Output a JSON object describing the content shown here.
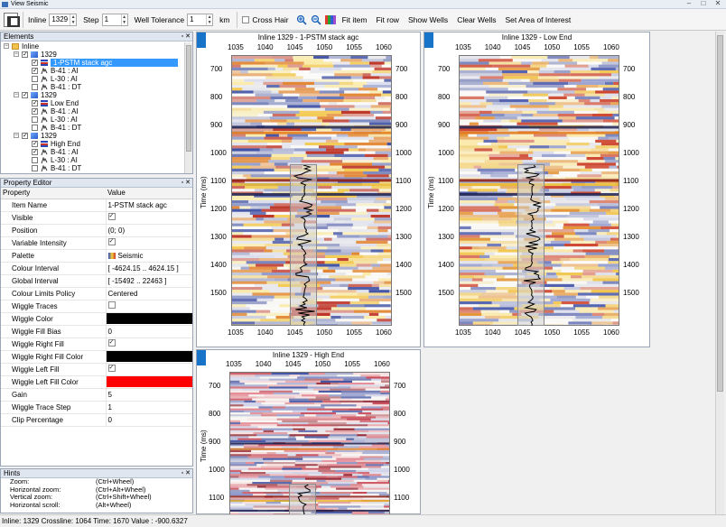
{
  "window": {
    "title": "View Seismic"
  },
  "toolbar": {
    "inline_label": "Inline",
    "inline_value": "1329",
    "step_label": "Step",
    "step_value": "1",
    "well_tolerance_label": "Well Tolerance",
    "well_tolerance_value": "1",
    "km_label": "km",
    "cross_hair_label": "Cross Hair",
    "fit_item_label": "Fit item",
    "fit_row_label": "Fit row",
    "show_wells_label": "Show Wells",
    "clear_wells_label": "Clear Wells",
    "set_area_label": "Set Area of Interest"
  },
  "elements_panel": {
    "title": "Elements",
    "root_label": "Inline",
    "groups": [
      {
        "label": "1329",
        "layer": "1-PSTM stack agc",
        "selected": true,
        "wells": [
          {
            "label": "B-41 : AI",
            "checked": true
          },
          {
            "label": "L-30 : AI",
            "checked": false
          },
          {
            "label": "B-41 : DT",
            "checked": false
          }
        ]
      },
      {
        "label": "1329",
        "layer": "Low End",
        "selected": false,
        "wells": [
          {
            "label": "B-41 : AI",
            "checked": true
          },
          {
            "label": "L-30 : AI",
            "checked": false
          },
          {
            "label": "B-41 : DT",
            "checked": false
          }
        ]
      },
      {
        "label": "1329",
        "layer": "High End",
        "selected": false,
        "wells": [
          {
            "label": "B-41 : AI",
            "checked": true
          },
          {
            "label": "L-30 : AI",
            "checked": false
          },
          {
            "label": "B-41 : DT",
            "checked": false
          }
        ]
      }
    ]
  },
  "property_editor": {
    "title": "Property Editor",
    "col_property": "Property",
    "col_value": "Value",
    "rows": [
      {
        "name": "Item Name",
        "value": "1-PSTM stack agc"
      },
      {
        "name": "Visible",
        "check": true
      },
      {
        "name": "Position",
        "value": "(0; 0)"
      },
      {
        "name": "Variable Intensity",
        "check": true
      },
      {
        "name": "Palette",
        "value": "Seismic",
        "palette": true
      },
      {
        "name": "Colour Interval",
        "value": "[ -4624.15 .. 4624.15 ]"
      },
      {
        "name": "Global Interval",
        "value": "[ -15492 .. 22463 ]"
      },
      {
        "name": "Colour Limits Policy",
        "value": "Centered"
      },
      {
        "name": "Wiggle Traces",
        "check": false
      },
      {
        "name": "Wiggle Color",
        "swatch": "#000000"
      },
      {
        "name": "Wiggle Fill Bias",
        "value": "0"
      },
      {
        "name": "Wiggle Right Fill",
        "check": true
      },
      {
        "name": "Wiggle Right Fill Color",
        "swatch": "#000000"
      },
      {
        "name": "Wiggle Left Fill",
        "check": true
      },
      {
        "name": "Wiggle Left Fill Color",
        "swatch": "#ff0000"
      },
      {
        "name": "Gain",
        "value": "5"
      },
      {
        "name": "Wiggle Trace Step",
        "value": "1"
      },
      {
        "name": "Clip Percentage",
        "value": "0"
      }
    ]
  },
  "hints": {
    "title": "Hints",
    "items": [
      {
        "action": "Zoom:",
        "keys": "(Ctrl+Wheel)"
      },
      {
        "action": "Horizontal zoom:",
        "keys": "(Ctrl+Alt+Wheel)"
      },
      {
        "action": "Vertical zoom:",
        "keys": "(Ctrl+Shift+Wheel)"
      },
      {
        "action": "Horizontal scroll:",
        "keys": "(Alt+Wheel)"
      }
    ]
  },
  "seismic_panels": [
    {
      "title": "Inline 1329 - 1-PSTM stack agc",
      "ylabel": "Time (ms)",
      "style": "agc",
      "x_ticks": [
        "1035",
        "1040",
        "1045",
        "1050",
        "1055",
        "1060"
      ],
      "y_ticks": [
        "700",
        "800",
        "900",
        "1000",
        "1100",
        "1200",
        "1300",
        "1400",
        "1500"
      ]
    },
    {
      "title": "Inline 1329 - Low End",
      "ylabel": "Time (ms)",
      "style": "low",
      "x_ticks": [
        "1035",
        "1040",
        "1045",
        "1050",
        "1055",
        "1060"
      ],
      "y_ticks": [
        "700",
        "800",
        "900",
        "1000",
        "1100",
        "1200",
        "1300",
        "1400",
        "1500"
      ]
    },
    {
      "title": "Inline 1329 - High End",
      "ylabel": "Time (ms)",
      "style": "high",
      "x_ticks": [
        "1035",
        "1040",
        "1045",
        "1050",
        "1055",
        "1060"
      ],
      "y_ticks": [
        "700",
        "800",
        "900",
        "1000",
        "1100"
      ]
    }
  ],
  "status": {
    "text": "Inline: 1329 Crossline: 1064 Time: 1670 Value : -900.6327"
  }
}
